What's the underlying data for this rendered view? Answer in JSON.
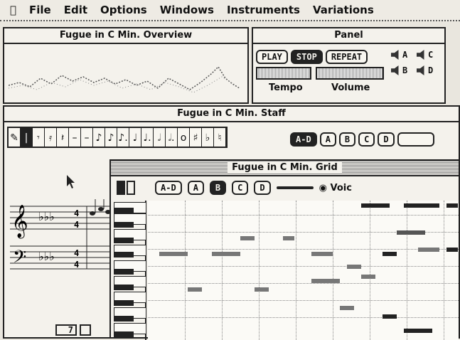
{
  "menubar": {
    "apple": "\u0000",
    "items": [
      "File",
      "Edit",
      "Options",
      "Windows",
      "Instruments",
      "Variations"
    ]
  },
  "overview": {
    "title": "Fugue in C Min. Overview"
  },
  "panel": {
    "title": "Panel",
    "play": "PLAY",
    "stop": "STOP",
    "repeat": "REPEAT",
    "tempo_label": "Tempo",
    "volume_label": "Volume",
    "voices": [
      "A",
      "C",
      "B",
      "D"
    ]
  },
  "staff": {
    "title": "Fugue in C Min. Staff",
    "tools": [
      "pencil",
      "bar",
      "rest-8",
      "rest-16",
      "rest-q",
      "rest-h",
      "rest-w",
      "note-8",
      "note-8",
      "note-8d",
      "note-q",
      "note-qd",
      "note-h",
      "note-hd",
      "note-w",
      "sharp",
      "flat",
      "natural"
    ],
    "voice_buttons": [
      "A-D",
      "A",
      "B",
      "C",
      "D"
    ],
    "measure_number": "7"
  },
  "grid": {
    "title": "Fugue in C Min. Grid",
    "voice_buttons": [
      "A-D",
      "A",
      "B",
      "C",
      "D"
    ],
    "voice_radio_label": "Voic"
  }
}
